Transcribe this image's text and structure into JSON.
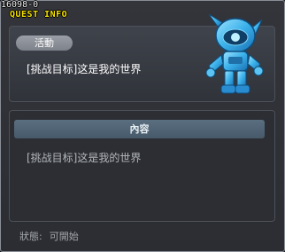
{
  "quest_id": "16098-0",
  "window_title": "QUEST INFO",
  "activity_badge": "活動",
  "activity_text": "[挑战目标]这是我的世界",
  "content_header": "內容",
  "content_text": "[挑战目标]这是我的世界",
  "status_label": "狀態:",
  "status_value": "可開始",
  "npc_icon": "blue-robot-npc-icon",
  "colors": {
    "title": "#f4e100",
    "panel_bg": "#3a3d44",
    "content_header_bg": "#506575"
  }
}
